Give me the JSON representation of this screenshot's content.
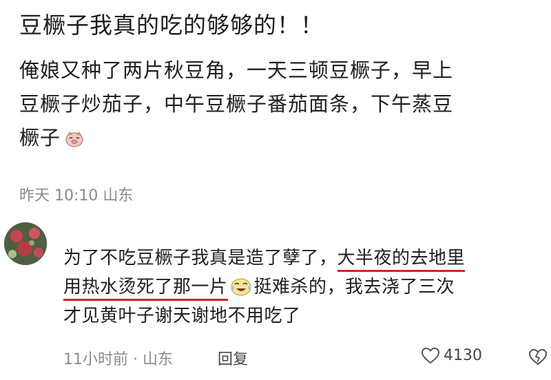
{
  "post": {
    "title": "豆橛子我真的吃的够够的！！",
    "body_line1": "俺娘又种了两片秋豆角，一天三顿豆橛子，早上",
    "body_line2": "豆橛子炒茄子，中午豆橛子番茄面条，下午蒸豆",
    "body_line3": "橛子",
    "meta": "昨天 10:10 山东",
    "emoji_icon": "pig-face-icon"
  },
  "comment": {
    "seg1": "为了不吃豆橛子我真是造了孽了，",
    "seg2_underlined": "大半夜的去地里",
    "seg3_underlined": "用热水烫死了那一片",
    "seg4": "挺难杀的，我去浇了三次",
    "seg5": "才见黄叶子谢天谢地不用吃了",
    "emoji_icon": "laughing-face-icon",
    "meta": "11小时前 · 山东",
    "reply_label": "回复",
    "like_count": "4130",
    "underline_color": "#cf2424"
  }
}
